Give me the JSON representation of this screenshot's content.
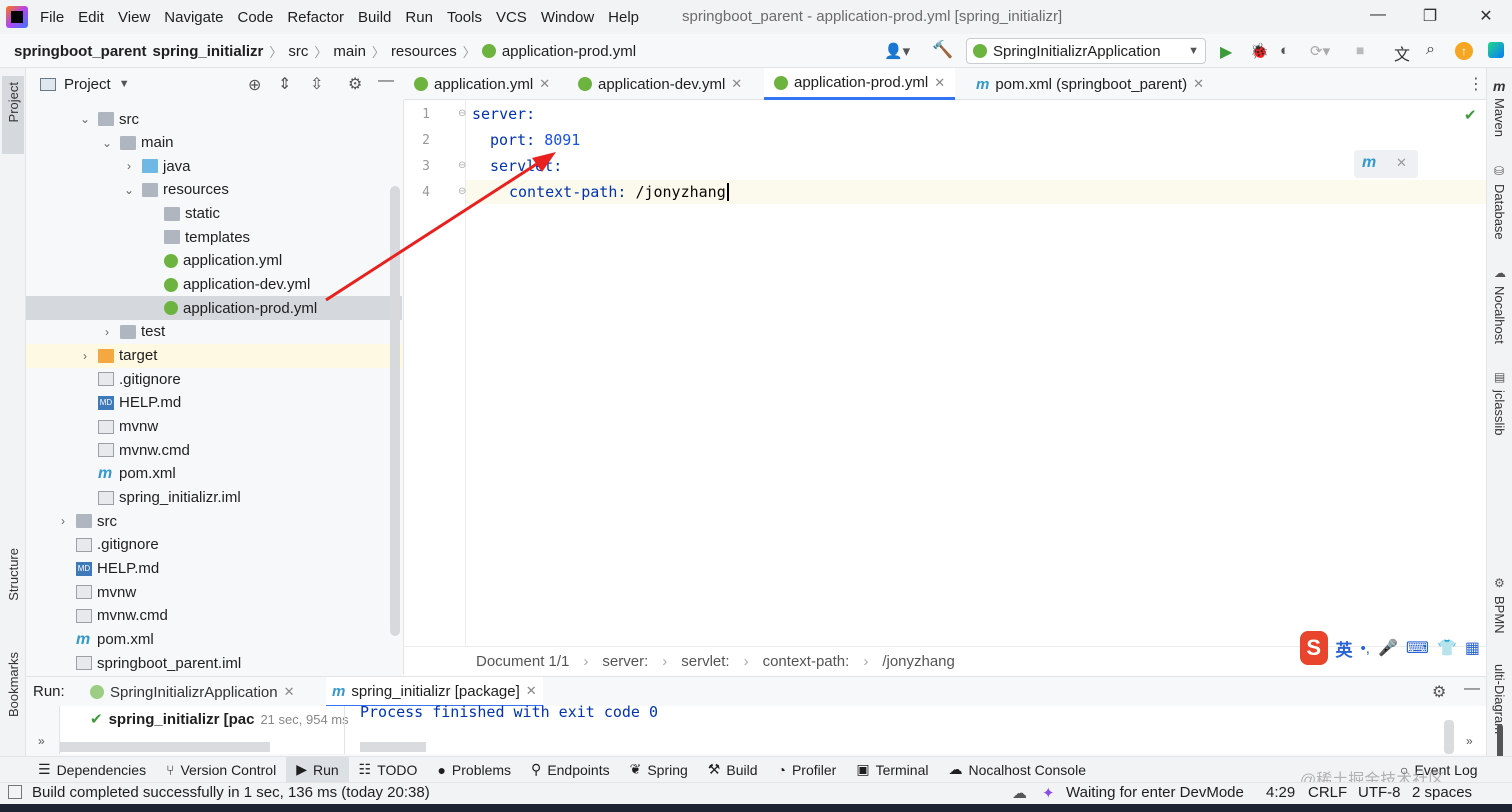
{
  "menu": {
    "items": [
      "File",
      "Edit",
      "View",
      "Navigate",
      "Code",
      "Refactor",
      "Build",
      "Run",
      "Tools",
      "VCS",
      "Window",
      "Help"
    ],
    "window_title": "springboot_parent - application-prod.yml [spring_initializr]"
  },
  "nav": {
    "crumbs": [
      "springboot_parent",
      "spring_initializr",
      "src",
      "main",
      "resources",
      "application-prod.yml"
    ],
    "run_config": "SpringInitializrApplication"
  },
  "left_stripe": {
    "project": "Project",
    "structure": "Structure",
    "bookmarks": "Bookmarks"
  },
  "right_stripe": {
    "maven": "Maven",
    "database": "Database",
    "nocalhost": "Nocalhost",
    "jclasslib": "jclasslib",
    "bpmn": "BPMN",
    "multi": "ulti-Diagram"
  },
  "project_panel": {
    "title": "Project",
    "tree": [
      {
        "label": "src",
        "icon": "folder",
        "arrow": "down"
      },
      {
        "label": "main",
        "icon": "folder",
        "arrow": "down"
      },
      {
        "label": "java",
        "icon": "folder-blue",
        "arrow": "right"
      },
      {
        "label": "resources",
        "icon": "folder",
        "arrow": "down"
      },
      {
        "label": "static",
        "icon": "folder",
        "arrow": ""
      },
      {
        "label": "templates",
        "icon": "folder",
        "arrow": ""
      },
      {
        "label": "application.yml",
        "icon": "spring-yml",
        "arrow": ""
      },
      {
        "label": "application-dev.yml",
        "icon": "spring-yml",
        "arrow": ""
      },
      {
        "label": "application-prod.yml",
        "icon": "spring-yml",
        "arrow": ""
      },
      {
        "label": "test",
        "icon": "folder",
        "arrow": "right"
      },
      {
        "label": "target",
        "icon": "folder-orange",
        "arrow": "right"
      },
      {
        "label": ".gitignore",
        "icon": "file",
        "arrow": ""
      },
      {
        "label": "HELP.md",
        "icon": "markdown",
        "arrow": ""
      },
      {
        "label": "mvnw",
        "icon": "file",
        "arrow": ""
      },
      {
        "label": "mvnw.cmd",
        "icon": "file",
        "arrow": ""
      },
      {
        "label": "pom.xml",
        "icon": "maven",
        "arrow": ""
      },
      {
        "label": "spring_initializr.iml",
        "icon": "file",
        "arrow": ""
      },
      {
        "label": "src",
        "icon": "folder",
        "arrow": "right"
      },
      {
        "label": ".gitignore",
        "icon": "file",
        "arrow": ""
      },
      {
        "label": "HELP.md",
        "icon": "markdown",
        "arrow": ""
      },
      {
        "label": "mvnw",
        "icon": "file",
        "arrow": ""
      },
      {
        "label": "mvnw.cmd",
        "icon": "file",
        "arrow": ""
      },
      {
        "label": "pom.xml",
        "icon": "maven",
        "arrow": ""
      },
      {
        "label": "springboot_parent.iml",
        "icon": "file",
        "arrow": ""
      }
    ]
  },
  "tabs": [
    "application.yml",
    "application-dev.yml",
    "application-prod.yml",
    "pom.xml (springboot_parent)"
  ],
  "editor": {
    "line_numbers": [
      "1",
      "2",
      "3",
      "4"
    ],
    "l1_key": "server:",
    "l2_key": "port: ",
    "l2_val": "8091",
    "l3_key": "servlet:",
    "l4_key": "context-path: ",
    "l4_val": "/jonyzhang"
  },
  "breadcrumb_bar": [
    "Document 1/1",
    "server:",
    "servlet:",
    "context-path:",
    "/jonyzhang"
  ],
  "run_panel": {
    "label": "Run:",
    "tab1": "SpringInitializrApplication",
    "tab2": "spring_initializr [package]",
    "tree_item": "spring_initializr [pac",
    "duration": "21 sec, 954 ms",
    "output": "Process finished with exit code 0"
  },
  "bottom_tools": [
    "Dependencies",
    "Version Control",
    "Run",
    "TODO",
    "Problems",
    "Endpoints",
    "Spring",
    "Build",
    "Profiler",
    "Terminal",
    "Nocalhost Console",
    "Event Log"
  ],
  "status": {
    "message": "Build completed successfully in 1 sec, 136 ms (today 20:38)",
    "devmode": "Waiting for enter DevMode",
    "position": "4:29",
    "line_sep": "CRLF",
    "encoding": "UTF-8",
    "indent": "2 spaces"
  },
  "ime": {
    "lang": "英"
  },
  "watermark": "@稀土掘金技术社区"
}
